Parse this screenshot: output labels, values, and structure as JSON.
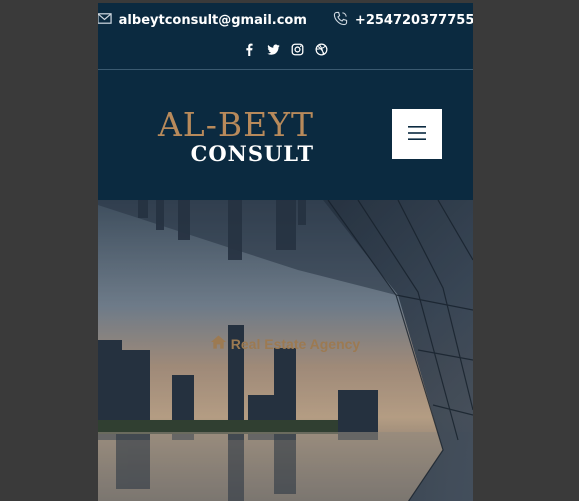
{
  "contact": {
    "email": "albeytconsult@gmail.com",
    "phone": "+254720377755",
    "email_icon": "envelope-icon",
    "phone_icon": "phone-icon"
  },
  "social": [
    "facebook-icon",
    "twitter-icon",
    "instagram-icon",
    "dribbble-icon"
  ],
  "brand": {
    "main": "AL-BEYT",
    "sub": "CONSULT",
    "main_color": "#b88a5b",
    "sub_color": "#ffffff"
  },
  "menu": {
    "icon": "hamburger-menu-icon"
  },
  "hero": {
    "badge": "Real Estate Agency",
    "badge_icon": "home-icon",
    "badge_color": "#9c7a52"
  },
  "colors": {
    "header_bg": "#0b2a40",
    "page_bg": "#3a3a3a"
  }
}
